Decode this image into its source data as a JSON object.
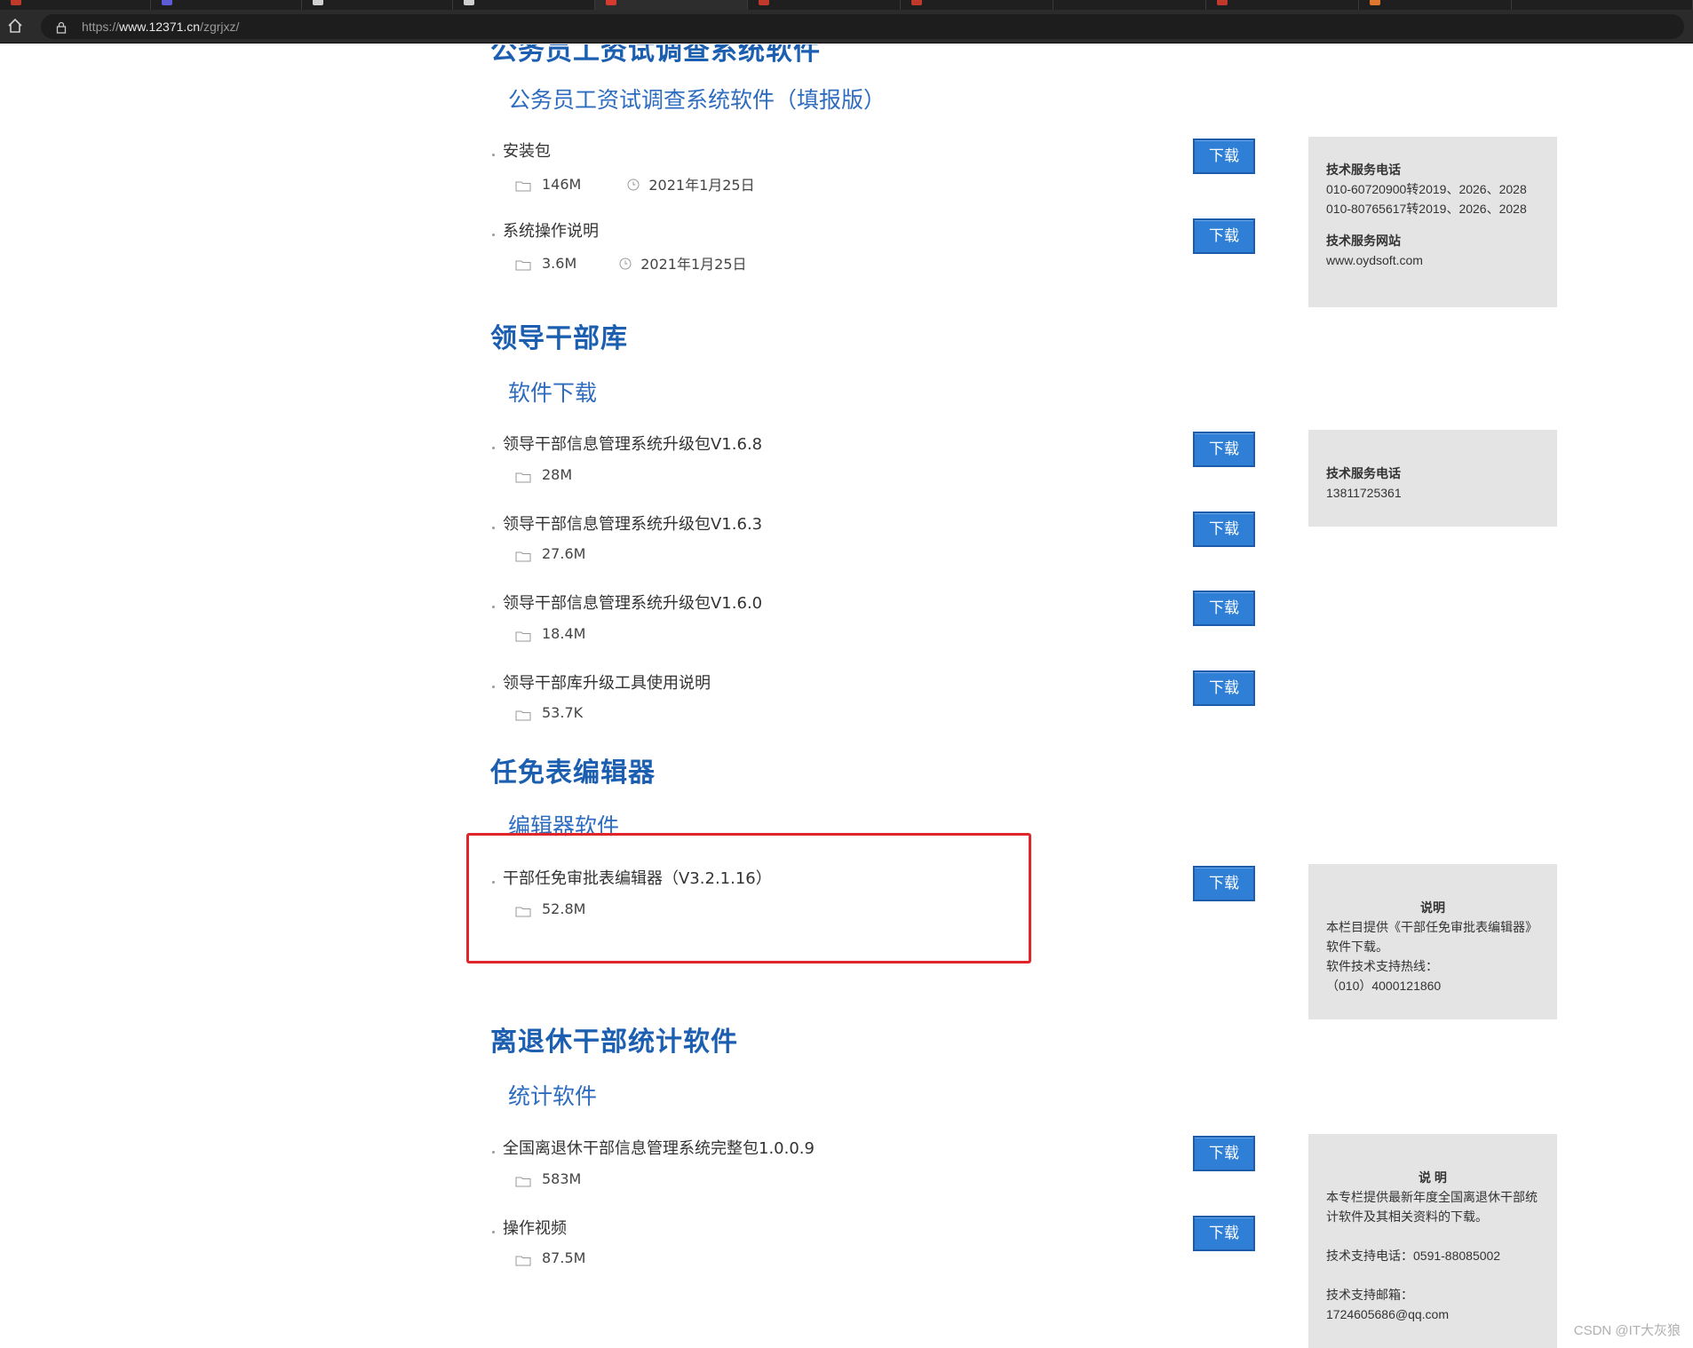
{
  "browser": {
    "url_scheme": "https://",
    "url_host": "www.12371.cn",
    "url_path": "/zgrjxz/"
  },
  "sections": {
    "s0_title": "公务员工资试调查系统软件",
    "s0_sub": "公务员工资试调查系统软件（填报版）",
    "s1_title": "领导干部库",
    "s1_sub": "软件下载",
    "s2_title": "任免表编辑器",
    "s2_sub": "编辑器软件",
    "s3_title": "离退休干部统计软件",
    "s3_sub": "统计软件"
  },
  "items": [
    {
      "name": "安装包",
      "size": "146M",
      "date": "2021年1月25日"
    },
    {
      "name": "系统操作说明",
      "size": "3.6M",
      "date": "2021年1月25日"
    },
    {
      "name": "领导干部信息管理系统升级包V1.6.8",
      "size": "28M"
    },
    {
      "name": "领导干部信息管理系统升级包V1.6.3",
      "size": "27.6M"
    },
    {
      "name": "领导干部信息管理系统升级包V1.6.0",
      "size": "18.4M"
    },
    {
      "name": "领导干部库升级工具使用说明",
      "size": "53.7K"
    },
    {
      "name": "干部任免审批表编辑器（V3.2.1.16）",
      "size": "52.8M"
    },
    {
      "name": "全国离退休干部信息管理系统完整包1.0.0.9",
      "size": "583M"
    },
    {
      "name": "操作视频",
      "size": "87.5M"
    }
  ],
  "download_label": "下载",
  "side_boxes": {
    "box1": {
      "phone_label": "技术服务电话",
      "phone_line1": "010-60720900转2019、2026、2028",
      "phone_line2": "010-80765617转2019、2026、2028",
      "site_label": "技术服务网站",
      "site": "www.oydsoft.com"
    },
    "box2": {
      "phone_label": "技术服务电话",
      "phone": "13811725361"
    },
    "box3": {
      "title": "说明",
      "line1": "本栏目提供《干部任免审批表编辑器》",
      "line2": "软件下载。",
      "line3": "软件技术支持热线：",
      "line4": "（010）4000121860"
    },
    "box4": {
      "title": "说 明",
      "line1": "本专栏提供最新年度全国离退休干部统",
      "line2": "计软件及其相关资料的下载。",
      "line3": "技术支持电话：0591-88085002",
      "line4": "技术支持邮箱：",
      "line5": "1724605686@qq.com"
    }
  },
  "watermark": "CSDN @IT大灰狼",
  "colors": {
    "section_title": "#1c5fb0",
    "download_button": "#2f7fd6",
    "highlight_frame": "#e0262a",
    "side_box_bg": "#e4e4e4"
  }
}
